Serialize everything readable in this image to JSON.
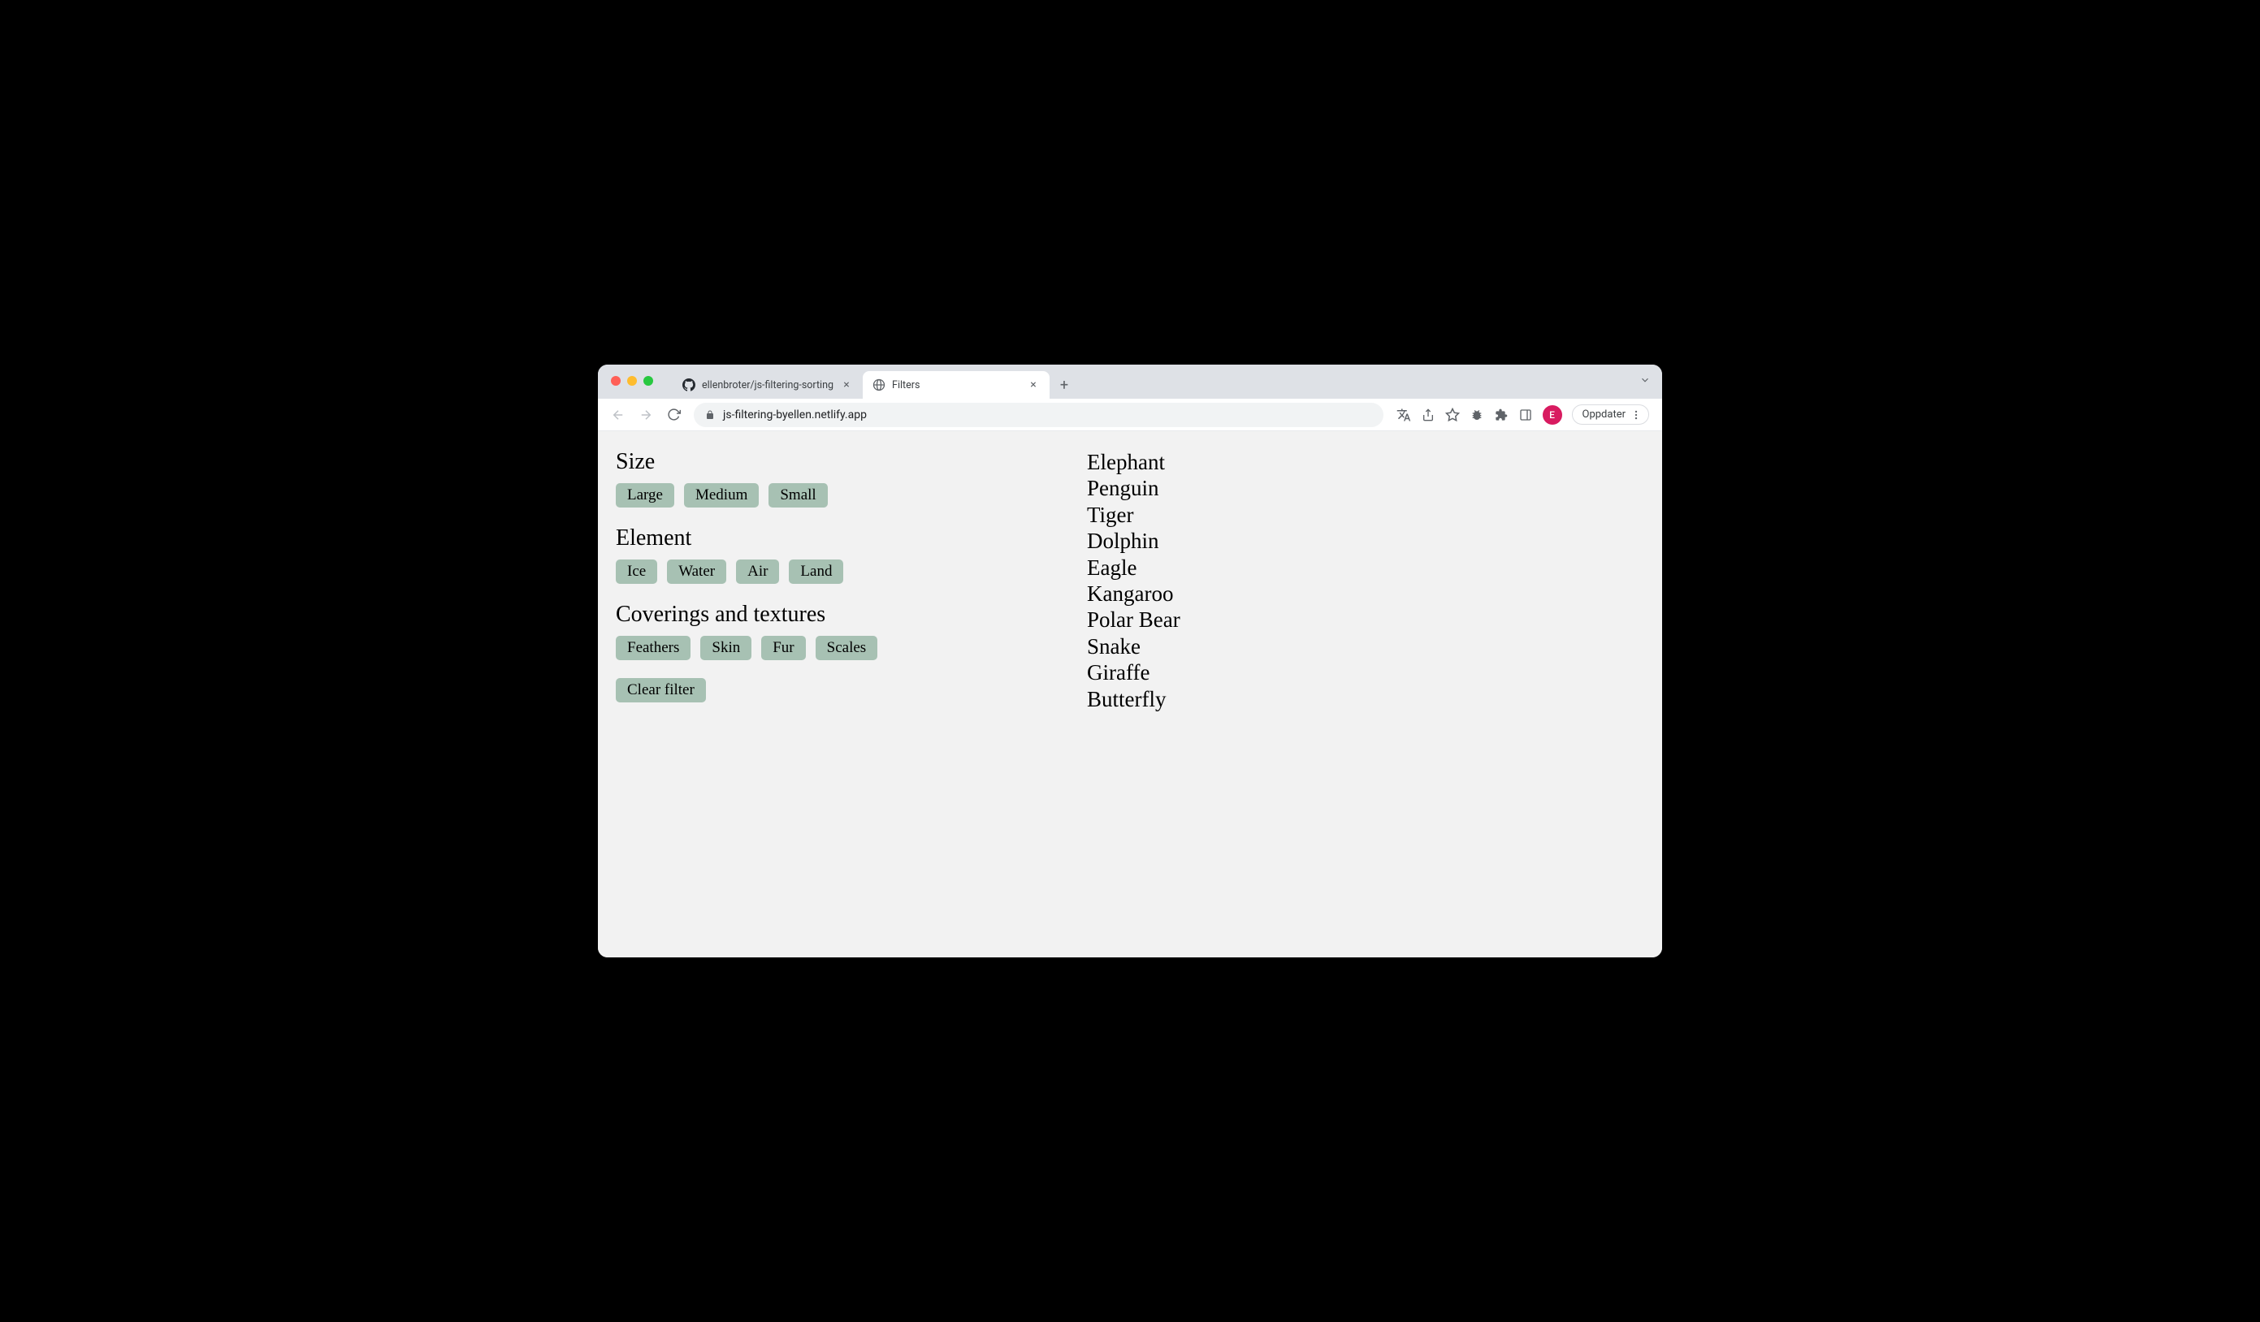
{
  "browser": {
    "tabs": [
      {
        "title": "ellenbroter/js-filtering-sorting",
        "favicon": "github",
        "active": false
      },
      {
        "title": "Filters",
        "favicon": "globe",
        "active": true
      }
    ],
    "url": "js-filtering-byellen.netlify.app",
    "update_label": "Oppdater",
    "avatar_letter": "E"
  },
  "page": {
    "filter_groups": [
      {
        "heading": "Size",
        "options": [
          "Large",
          "Medium",
          "Small"
        ]
      },
      {
        "heading": "Element",
        "options": [
          "Ice",
          "Water",
          "Air",
          "Land"
        ]
      },
      {
        "heading": "Coverings and textures",
        "options": [
          "Feathers",
          "Skin",
          "Fur",
          "Scales"
        ]
      }
    ],
    "clear_label": "Clear filter",
    "results": [
      "Elephant",
      "Penguin",
      "Tiger",
      "Dolphin",
      "Eagle",
      "Kangaroo",
      "Polar Bear",
      "Snake",
      "Giraffe",
      "Butterfly"
    ]
  }
}
